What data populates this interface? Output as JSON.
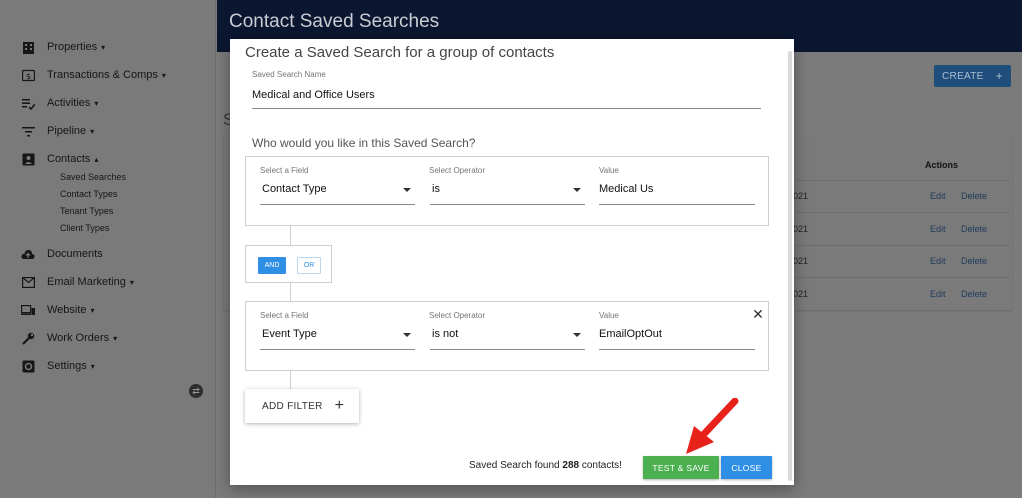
{
  "sidebar": {
    "items": [
      {
        "label": "Properties",
        "icon": "building-icon",
        "chevron": "▾"
      },
      {
        "label": "Transactions & Comps",
        "icon": "dollar-icon",
        "chevron": "▾"
      },
      {
        "label": "Activities",
        "icon": "checklist-icon",
        "chevron": "▾"
      },
      {
        "label": "Pipeline",
        "icon": "filter-lines-icon",
        "chevron": "▾"
      },
      {
        "label": "Contacts",
        "icon": "contact-card-icon",
        "chevron": "▴"
      },
      {
        "label": "Documents",
        "icon": "cloud-upload-icon",
        "chevron": ""
      },
      {
        "label": "Email Marketing",
        "icon": "mail-icon",
        "chevron": "▾"
      },
      {
        "label": "Website",
        "icon": "devices-icon",
        "chevron": "▾"
      },
      {
        "label": "Work Orders",
        "icon": "wrench-icon",
        "chevron": "▾"
      },
      {
        "label": "Settings",
        "icon": "settings-icon",
        "chevron": "▾"
      }
    ],
    "contacts_sub": [
      "Saved Searches",
      "Contact Types",
      "Tenant Types",
      "Client Types"
    ]
  },
  "header": {
    "title": "Contact Saved Searches"
  },
  "main": {
    "partial_heading": "S",
    "create_label": "CREATE",
    "table": {
      "col_partial": "l",
      "actions_label": "Actions",
      "rows": [
        {
          "date_partial": "021",
          "edit": "Edit",
          "delete": "Delete"
        },
        {
          "date_partial": "021",
          "edit": "Edit",
          "delete": "Delete"
        },
        {
          "date_partial": "021",
          "edit": "Edit",
          "delete": "Delete"
        },
        {
          "date_partial": "021",
          "edit": "Edit",
          "delete": "Delete"
        }
      ]
    }
  },
  "modal": {
    "title": "Create a Saved Search for a group of contacts",
    "name_label": "Saved Search Name",
    "name_value": "Medical and Office Users",
    "question": "Who would you like in this Saved Search?",
    "filters": [
      {
        "field_label": "Select a Field",
        "field_value": "Contact Type",
        "operator_label": "Select Operator",
        "operator_value": "is",
        "value_label": "Value",
        "value": "Medical Us"
      },
      {
        "field_label": "Select a Field",
        "field_value": "Event Type",
        "operator_label": "Select Operator",
        "operator_value": "is not",
        "value_label": "Value",
        "value": "EmailOptOut"
      }
    ],
    "logic": {
      "and_label": "AND",
      "or_label": "OR"
    },
    "add_filter_label": "ADD FILTER",
    "found_prefix": "Saved Search found ",
    "found_count": "288",
    "found_suffix": " contacts!",
    "test_save_label": "TEST & SAVE",
    "close_label": "CLOSE"
  },
  "colors": {
    "header_bg": "#0b1630",
    "accent_blue": "#2f8fe5",
    "success_green": "#4caf50",
    "arrow_red": "#e8211a"
  }
}
